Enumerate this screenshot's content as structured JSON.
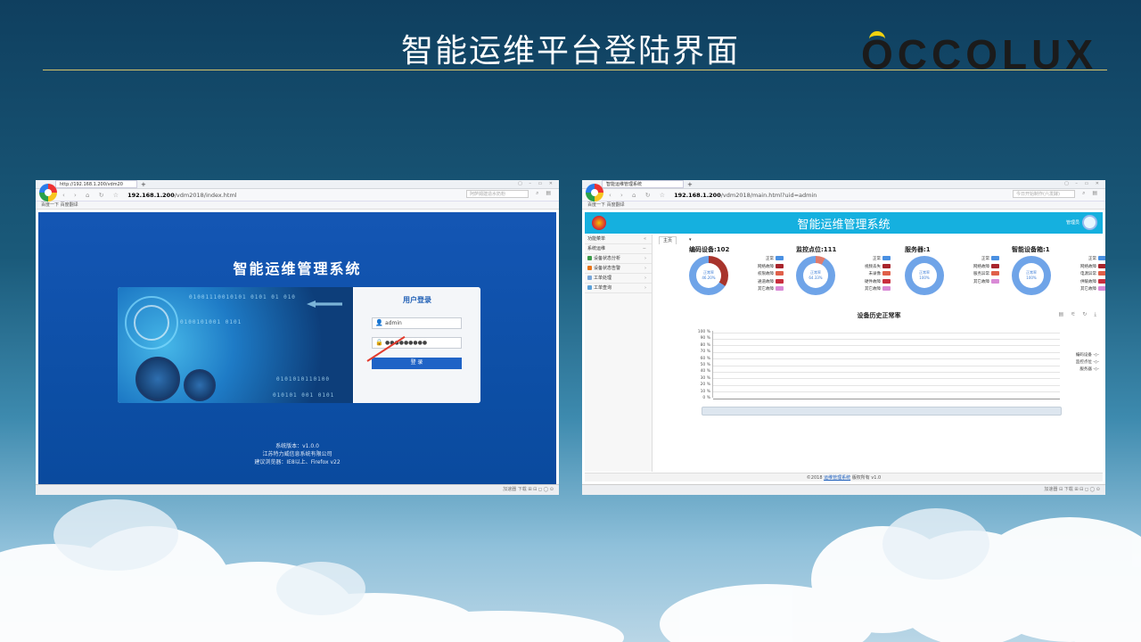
{
  "slide": {
    "title": "智能运维平台登陆界面",
    "brand": "OCCOLUX"
  },
  "login_screenshot": {
    "browser": {
      "tab_label": "http://192.168.1.200/vdm20",
      "url_host": "192.168.1.200",
      "url_path": "/vdm2018/index.html",
      "search_placeholder": "阿萨姆建造水奶粉",
      "bookmarks": "百度一下    百度翻译",
      "status_right": "加速器  下载  ⊞  ⊟  ◻  ◯  ⊙"
    },
    "system_title": "智能运维管理系统",
    "form": {
      "title": "用户登录",
      "username_value": "admin",
      "password_value": "●●●●●●●●●",
      "login_button": "登  录"
    },
    "art_binary": [
      "01001110010101  0101  01  010",
      "0100101001  0101",
      "0101010110100",
      "010101 001 0101"
    ],
    "footer": {
      "version": "系统版本：v1.0.0",
      "company": "江苏特力威信息系统有限公司",
      "browser_hint": "建议浏览器：IE8以上、Firefox v22"
    }
  },
  "dashboard_screenshot": {
    "browser": {
      "tab_label": "智能运维管理系统",
      "url_host": "192.168.1.200",
      "url_path": "/vdm2018/main.html?uid=admin",
      "search_placeholder": "今日开始制作(六发酵)",
      "bookmarks": "百度一下    百度翻译",
      "status_right": "加速器  ⊟  下载  ⊞  ⊟  ◻  ◯  ⊙"
    },
    "header": {
      "title": "智能运维管理系统",
      "user": "管理员"
    },
    "sidebar": [
      {
        "label": "功能菜单",
        "chev": "«"
      },
      {
        "label": "系统运维",
        "chev": "−"
      },
      {
        "label": "设备状态分析",
        "chev": "›",
        "color": "#3c9a4a"
      },
      {
        "label": "设备状态告警",
        "chev": "›",
        "color": "#e8751a"
      },
      {
        "label": "工单处理",
        "chev": "›",
        "color": "#7aa7d9"
      },
      {
        "label": "工单查询",
        "chev": "›",
        "color": "#5aa0d8"
      }
    ],
    "main_tab": "主页",
    "main_tab_caret": "▾",
    "stats": [
      {
        "title": "编码设备:102",
        "center": "正常率\n46.20%",
        "legend": [
          "正常",
          "网络故障",
          "权限故障",
          "通道故障",
          "其它故障"
        ],
        "colors": [
          "#4a90e2",
          "#a8242c",
          "#e0604a",
          "#c92f3f",
          "#d98ad6"
        ],
        "ring": "conic-gradient(#a8342c 0 34%,#6fa4e8 34% 100%)"
      },
      {
        "title": "监控点位:111",
        "center": "正常率\n64.33%",
        "legend": [
          "正常",
          "视频丢失",
          "未录像",
          "硬件故障",
          "其它故障"
        ],
        "colors": [
          "#4a90e2",
          "#a8242c",
          "#e0604a",
          "#c92f3f",
          "#d98ad6"
        ],
        "ring": "conic-gradient(#e07b6b 0 8%,#6fa4e8 8% 100%)"
      },
      {
        "title": "服务器:1",
        "center": "正常率\n100%",
        "legend": [
          "正常",
          "网络故障",
          "服务异常",
          "其它故障"
        ],
        "colors": [
          "#4a90e2",
          "#a8242c",
          "#e0604a",
          "#d98ad6"
        ],
        "ring": "conic-gradient(#6fa4e8 0 100%)"
      },
      {
        "title": "智能设备箱:1",
        "center": "正常率\n100%",
        "legend": [
          "正常",
          "网络故障",
          "电源异常",
          "供暖故障",
          "其它故障"
        ],
        "colors": [
          "#4a90e2",
          "#a8242c",
          "#e0604a",
          "#c92f3f",
          "#d98ad6"
        ],
        "ring": "conic-gradient(#6fa4e8 0 100%)"
      }
    ],
    "history": {
      "title": "设备历史正常率",
      "tools": "▤ ⚟ ↻ ⤓",
      "yticks": [
        "100 %",
        "90 %",
        "80 %",
        "70 %",
        "60 %",
        "50 %",
        "40 %",
        "30 %",
        "20 %",
        "10 %",
        "0 %"
      ],
      "legend": [
        "编码设备 -◇-",
        "监控点位 -◇-",
        "服务器 -◇-"
      ]
    },
    "footer": {
      "prefix": "©2018 ",
      "link": "运维管理系统",
      "suffix": " 版权所有 v1.0"
    }
  }
}
